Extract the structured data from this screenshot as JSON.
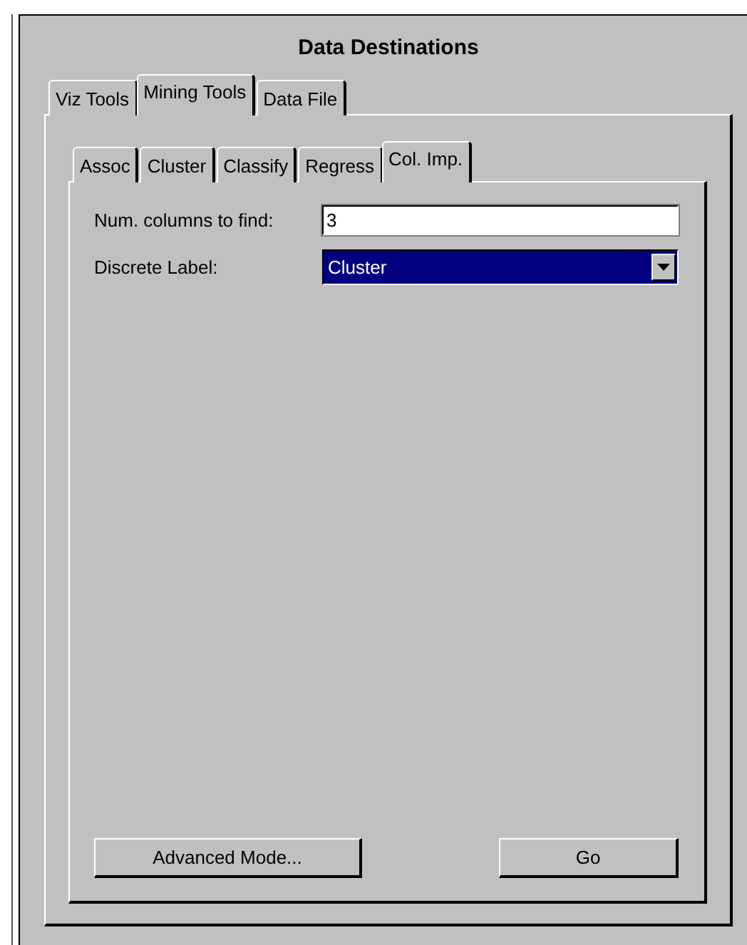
{
  "panel": {
    "title": "Data Destinations"
  },
  "tabs": [
    {
      "label": "Viz Tools",
      "selected": false
    },
    {
      "label": "Mining Tools",
      "selected": true
    },
    {
      "label": "Data File",
      "selected": false
    }
  ],
  "subtabs": [
    {
      "label": "Assoc",
      "selected": false
    },
    {
      "label": "Cluster",
      "selected": false
    },
    {
      "label": "Classify",
      "selected": false
    },
    {
      "label": "Regress",
      "selected": false
    },
    {
      "label": "Col. Imp.",
      "selected": true
    }
  ],
  "form": [
    {
      "kind": "text",
      "label": "Num. columns to find:",
      "value": "3"
    },
    {
      "kind": "dropdown",
      "label": "Discrete Label:",
      "value": "Cluster"
    }
  ],
  "buttons": [
    {
      "label": "Advanced Mode..."
    },
    {
      "label": "Go"
    }
  ]
}
